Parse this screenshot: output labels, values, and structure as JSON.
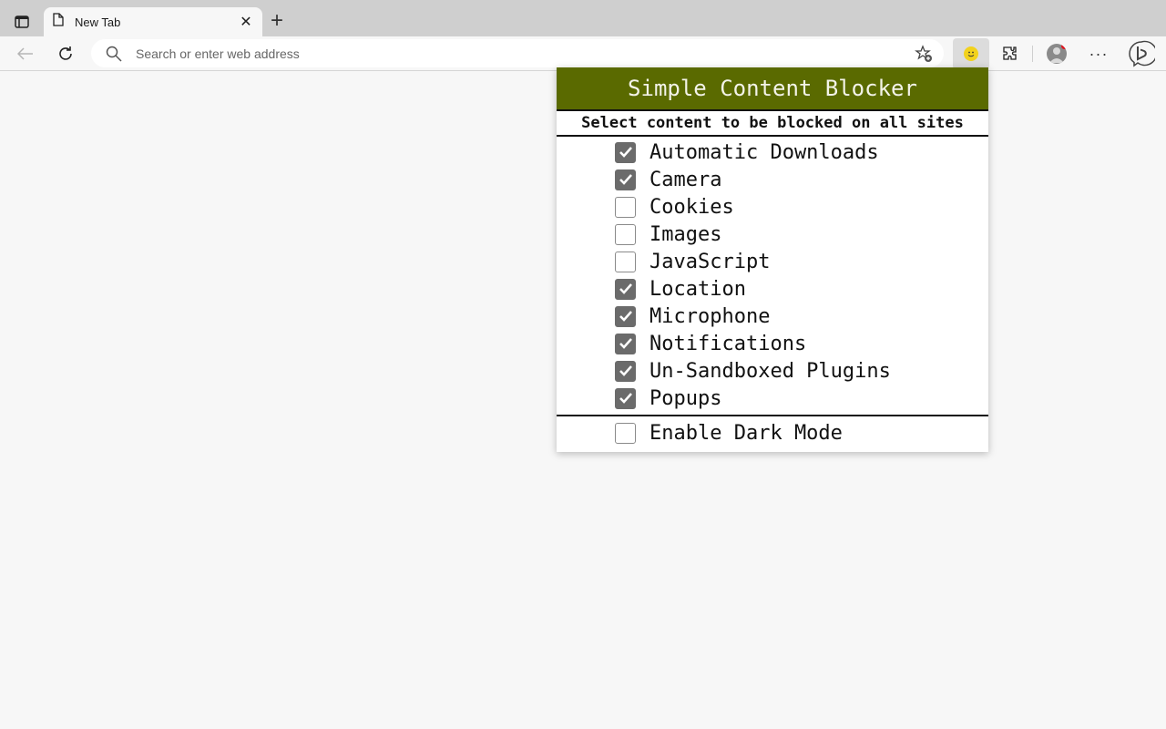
{
  "browser": {
    "tab": {
      "title": "New Tab"
    },
    "address_bar": {
      "placeholder": "Search or enter web address",
      "value": ""
    },
    "icons": [
      "tab-actions-icon",
      "page-icon",
      "close-icon",
      "plus-icon",
      "back-arrow-icon",
      "reload-icon",
      "search-icon",
      "favorite-add-icon",
      "smiley-extension-icon",
      "puzzle-extensions-icon",
      "profile-avatar-icon",
      "more-dots-icon",
      "bing-chat-icon"
    ],
    "more_label": "···"
  },
  "popup": {
    "title": "Simple Content Blocker",
    "subtitle": "Select content to be blocked on all sites",
    "header_color": "#5a6a00",
    "options": [
      {
        "label": "Automatic Downloads",
        "checked": true
      },
      {
        "label": "Camera",
        "checked": true
      },
      {
        "label": "Cookies",
        "checked": false
      },
      {
        "label": "Images",
        "checked": false
      },
      {
        "label": "JavaScript",
        "checked": false
      },
      {
        "label": "Location",
        "checked": true
      },
      {
        "label": "Microphone",
        "checked": true
      },
      {
        "label": "Notifications",
        "checked": true
      },
      {
        "label": "Un-Sandboxed Plugins",
        "checked": true
      },
      {
        "label": "Popups",
        "checked": true
      }
    ],
    "dark_mode": {
      "label": "Enable Dark Mode",
      "checked": false
    }
  }
}
